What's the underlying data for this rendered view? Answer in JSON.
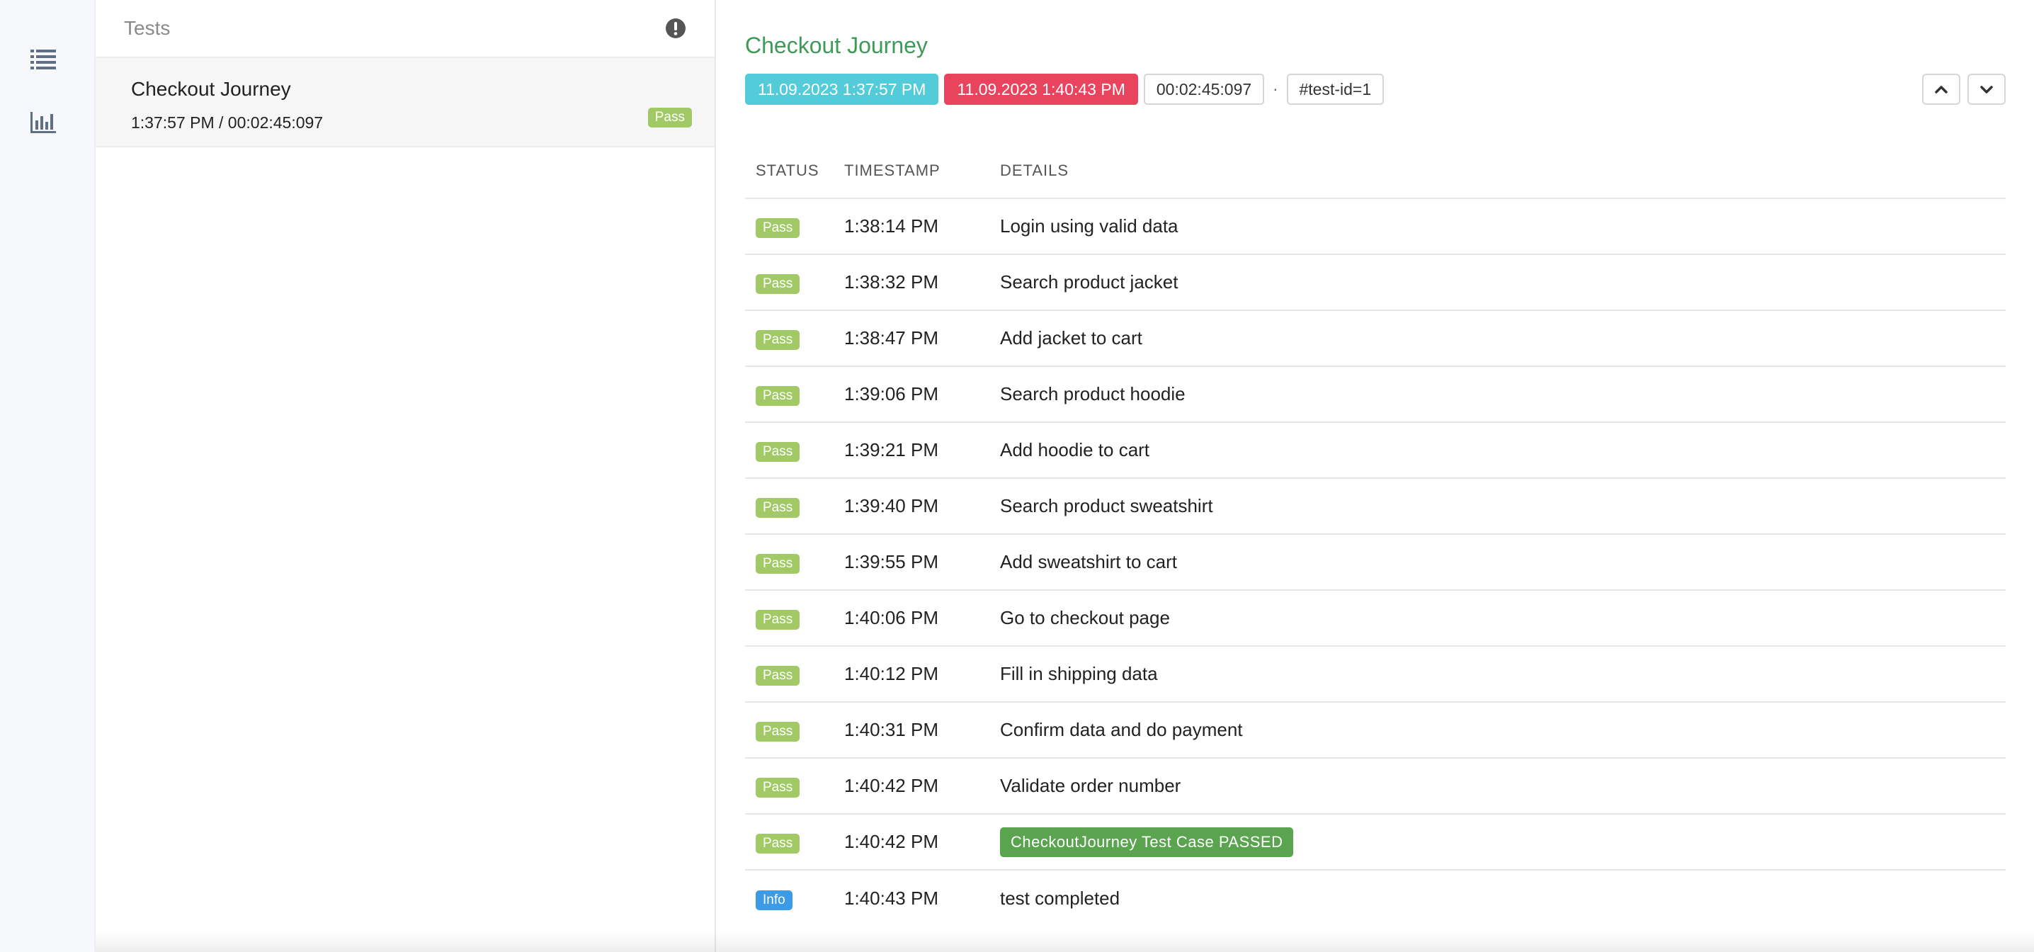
{
  "rail": {
    "icons": [
      "list-icon",
      "bar-chart-icon"
    ]
  },
  "list": {
    "title": "Tests",
    "header_icon": "exclamation-circle-icon",
    "tests": [
      {
        "name": "Checkout Journey",
        "meta": "1:37:57 PM / 00:02:45:097",
        "status": "Pass"
      }
    ]
  },
  "detail": {
    "title": "Checkout Journey",
    "start": "11.09.2023 1:37:57 PM",
    "end": "11.09.2023 1:40:43 PM",
    "duration": "00:02:45:097",
    "separator": "·",
    "test_id": "#test-id=1",
    "nav_icons": [
      "chevron-up-icon",
      "chevron-down-icon"
    ],
    "columns": {
      "status": "STATUS",
      "timestamp": "TIMESTAMP",
      "details": "DETAILS"
    },
    "steps": [
      {
        "status": "Pass",
        "time": "1:38:14 PM",
        "details": "Login using valid data"
      },
      {
        "status": "Pass",
        "time": "1:38:32 PM",
        "details": "Search product jacket"
      },
      {
        "status": "Pass",
        "time": "1:38:47 PM",
        "details": "Add jacket to cart"
      },
      {
        "status": "Pass",
        "time": "1:39:06 PM",
        "details": "Search product hoodie"
      },
      {
        "status": "Pass",
        "time": "1:39:21 PM",
        "details": "Add hoodie to cart"
      },
      {
        "status": "Pass",
        "time": "1:39:40 PM",
        "details": "Search product sweatshirt"
      },
      {
        "status": "Pass",
        "time": "1:39:55 PM",
        "details": "Add sweatshirt to cart"
      },
      {
        "status": "Pass",
        "time": "1:40:06 PM",
        "details": "Go to checkout page"
      },
      {
        "status": "Pass",
        "time": "1:40:12 PM",
        "details": "Fill in shipping data"
      },
      {
        "status": "Pass",
        "time": "1:40:31 PM",
        "details": "Confirm data and do payment"
      },
      {
        "status": "Pass",
        "time": "1:40:42 PM",
        "details": "Validate order number"
      },
      {
        "status": "Pass",
        "time": "1:40:42 PM",
        "details": "CheckoutJourney Test Case PASSED",
        "highlight": true
      },
      {
        "status": "Info",
        "time": "1:40:43 PM",
        "details": "test completed"
      }
    ]
  },
  "colors": {
    "accent_green": "#3e9a58",
    "pass": "#a1c965",
    "info": "#3d9be6",
    "start_tag": "#54cbd9",
    "end_tag": "#e9445e",
    "passed_badge": "#5aa450"
  }
}
